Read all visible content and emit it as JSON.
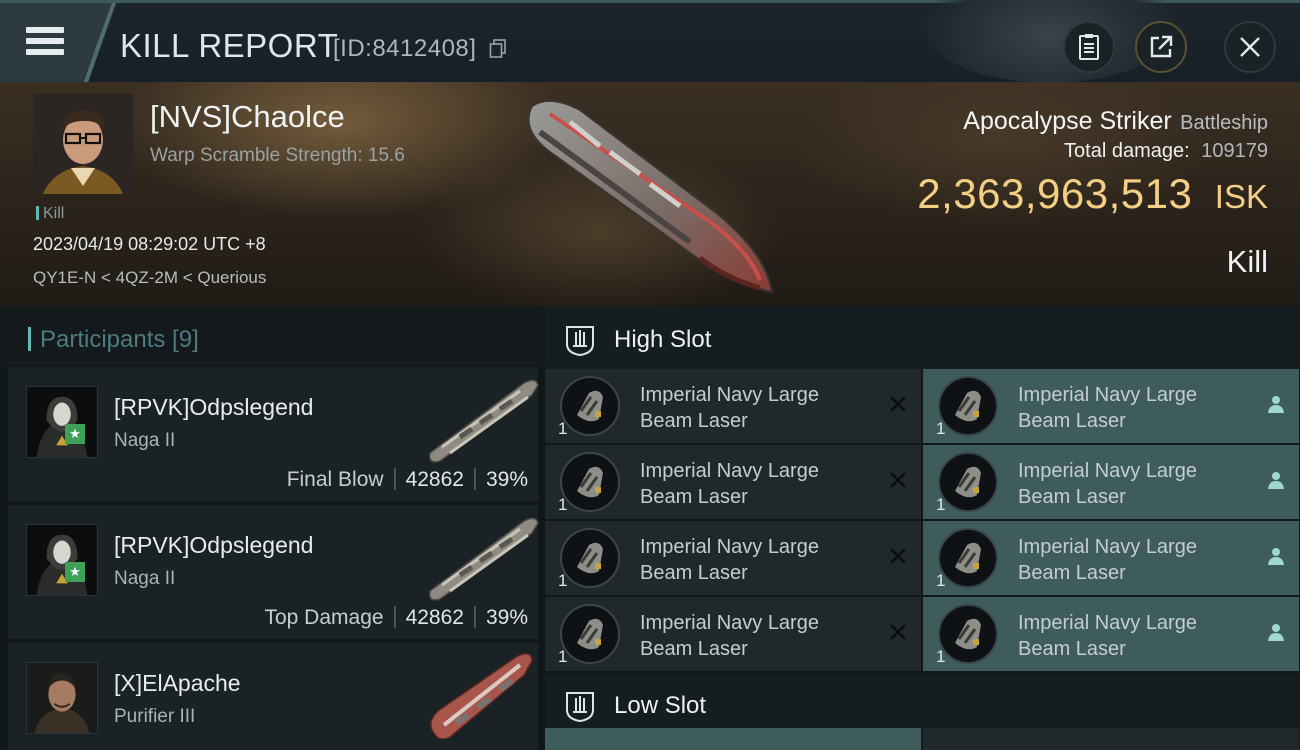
{
  "header": {
    "title": "KILL REPORT",
    "report_id": "[ID:8412408]",
    "icons": {
      "menu": "hamburger-menu-icon",
      "copy": "copy-icon",
      "clipboard": "clipboard-icon",
      "share": "share-icon",
      "close": "close-icon"
    }
  },
  "victim": {
    "pilot": "[NVS]Chaolce",
    "warp_scramble": "Warp Scramble Strength: 15.6",
    "tag": "Kill",
    "datetime": "2023/04/19 08:29:02 UTC +8",
    "location": "QY1E-N < 4QZ-2M < Querious",
    "ship_name": "Apocalypse Striker",
    "ship_class": "Battleship",
    "total_damage_label": "Total damage:",
    "total_damage": "109179",
    "isk_value": "2,363,963,513",
    "isk_unit": "ISK",
    "result": "Kill"
  },
  "participants": {
    "title": "Participants [9]",
    "items": [
      {
        "name": "[RPVK]Odpslegend",
        "ship": "Naga II",
        "role": "Final Blow",
        "damage": "42862",
        "percent": "39%",
        "starred": true
      },
      {
        "name": "[RPVK]Odpslegend",
        "ship": "Naga II",
        "role": "Top Damage",
        "damage": "42862",
        "percent": "39%",
        "starred": true
      },
      {
        "name": "[X]ElApache",
        "ship": "Purifier III",
        "role": "",
        "damage": "",
        "percent": "",
        "starred": false
      }
    ]
  },
  "slots": {
    "high": {
      "title": "High Slot",
      "left": [
        {
          "line1": "Imperial Navy Large",
          "line2": "Beam Laser",
          "qty": "1",
          "status": "destroyed"
        },
        {
          "line1": "Imperial Navy Large",
          "line2": "Beam Laser",
          "qty": "1",
          "status": "destroyed"
        },
        {
          "line1": "Imperial Navy Large",
          "line2": "Beam Laser",
          "qty": "1",
          "status": "destroyed"
        },
        {
          "line1": "Imperial Navy Large",
          "line2": "Beam Laser",
          "qty": "1",
          "status": "destroyed"
        }
      ],
      "right": [
        {
          "line1": "Imperial Navy Large",
          "line2": "Beam Laser",
          "qty": "1",
          "status": "dropped"
        },
        {
          "line1": "Imperial Navy Large",
          "line2": "Beam Laser",
          "qty": "1",
          "status": "dropped"
        },
        {
          "line1": "Imperial Navy Large",
          "line2": "Beam Laser",
          "qty": "1",
          "status": "dropped"
        },
        {
          "line1": "Imperial Navy Large",
          "line2": "Beam Laser",
          "qty": "1",
          "status": "dropped"
        }
      ]
    },
    "low": {
      "title": "Low Slot"
    }
  },
  "colors": {
    "accent_teal": "#5fb8b3",
    "isk_gold": "#f2cf84",
    "fitted_bg": "#3d5c5b",
    "star_green": "#3fa05a"
  }
}
